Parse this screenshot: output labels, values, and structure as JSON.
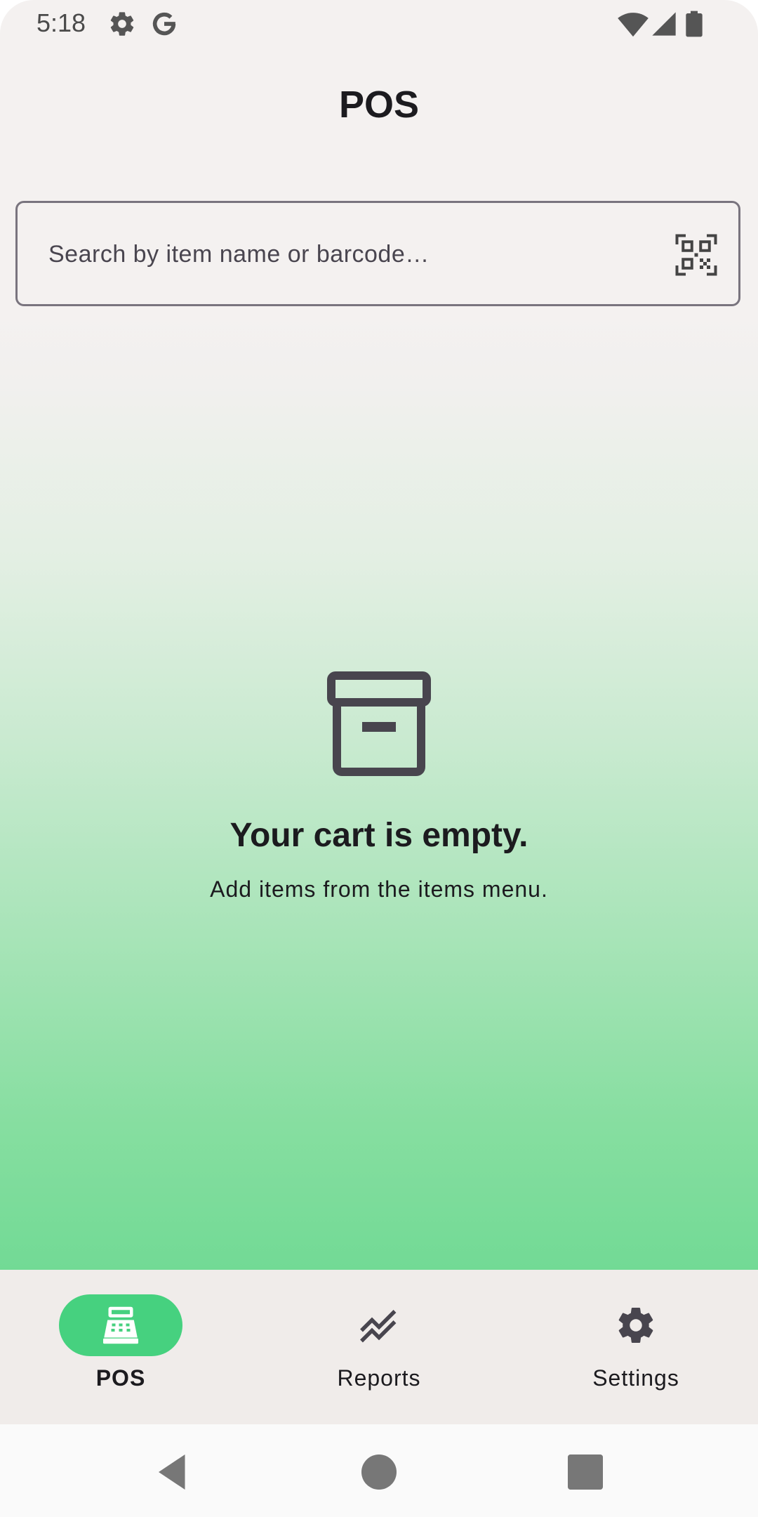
{
  "status_bar": {
    "time": "5:18",
    "icons": [
      "gear-icon",
      "google-icon",
      "wifi-icon",
      "signal-icon",
      "battery-icon"
    ]
  },
  "app_bar": {
    "title": "POS"
  },
  "search": {
    "placeholder": "Search by item name or barcode…",
    "value": "",
    "scan_icon": "qr-code-scan-icon"
  },
  "empty_state": {
    "icon": "archive-box-icon",
    "title": "Your cart is empty.",
    "subtitle": "Add items from the items menu."
  },
  "bottom_nav": {
    "items": [
      {
        "label": "POS",
        "icon": "cash-register-icon",
        "active": true
      },
      {
        "label": "Reports",
        "icon": "trending-chart-icon",
        "active": false
      },
      {
        "label": "Settings",
        "icon": "gear-icon",
        "active": false
      }
    ]
  },
  "system_nav": {
    "buttons": [
      "back-icon",
      "home-icon",
      "recents-icon"
    ]
  },
  "colors": {
    "accent": "#46d17f",
    "background": "#f4f1f0",
    "gradient_bottom": "#72da95",
    "text": "#1c1b1f"
  }
}
